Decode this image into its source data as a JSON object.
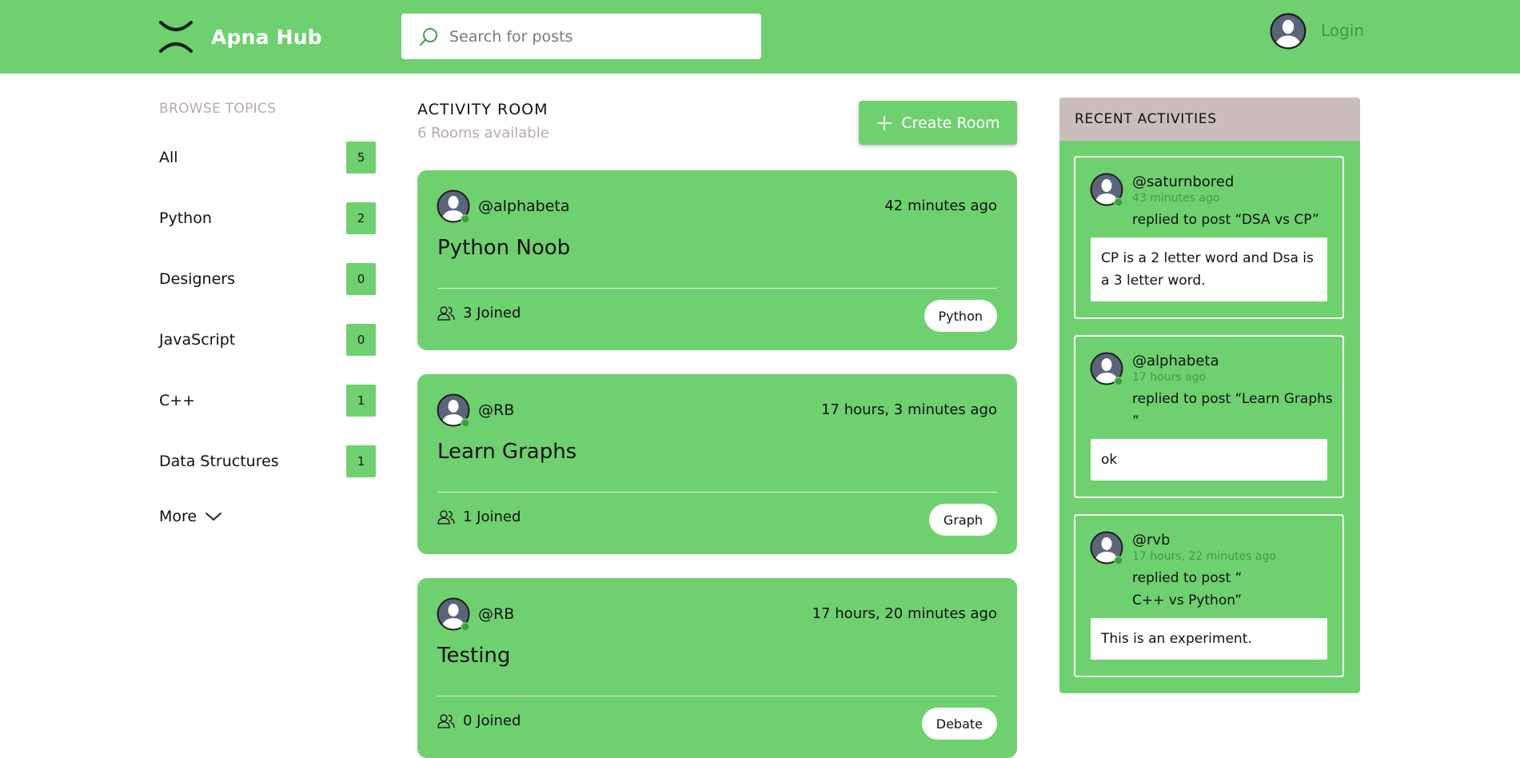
{
  "header": {
    "brand": "Apna Hub",
    "search_placeholder": "Search for posts",
    "login_label": "Login"
  },
  "topics": {
    "title": "BROWSE TOPICS",
    "items": [
      {
        "label": "All",
        "count": "5"
      },
      {
        "label": "Python",
        "count": "2"
      },
      {
        "label": "Designers",
        "count": "0"
      },
      {
        "label": "JavaScript",
        "count": "0"
      },
      {
        "label": "C++",
        "count": "1"
      },
      {
        "label": "Data Structures",
        "count": "1"
      }
    ],
    "more_label": "More"
  },
  "feed": {
    "title": "ACTIVITY ROOM",
    "subtitle": "6 Rooms available",
    "create_label": "Create Room",
    "rooms": [
      {
        "host": "@alphabeta",
        "time": "42 minutes ago",
        "title": "Python Noob",
        "joined": "3 Joined",
        "topic": "Python"
      },
      {
        "host": "@RB",
        "time": "17 hours, 3 minutes ago",
        "title": "Learn Graphs",
        "joined": "1 Joined",
        "topic": "Graph"
      },
      {
        "host": "@RB",
        "time": "17 hours, 20 minutes ago",
        "title": "Testing",
        "joined": "0 Joined",
        "topic": "Debate"
      }
    ]
  },
  "activities": {
    "title": "RECENT ACTIVITIES",
    "items": [
      {
        "user": "@saturnbored",
        "time": "43 minutes ago",
        "action": "replied to post “DSA vs CP”",
        "message": "CP is a 2 letter word and Dsa is a 3 letter word."
      },
      {
        "user": "@alphabeta",
        "time": "17 hours ago",
        "action": "replied to post “Learn Graphs ”",
        "message": "ok"
      },
      {
        "user": "@rvb",
        "time": "17 hours, 22 minutes ago",
        "action": "replied to post “\nC++ vs Python”",
        "message": "This is an experiment."
      }
    ]
  },
  "colors": {
    "primary_green": "#6fd070",
    "muted_label": "#b9a9ab",
    "activities_header": "#cbbdbe",
    "online_dot": "#3f9e44",
    "link_green": "#3e9a45"
  },
  "icons": {
    "logo": "x-logo-icon",
    "search": "search-icon",
    "avatar": "user-avatar-icon",
    "plus": "plus-icon",
    "users": "users-icon",
    "chevron": "chevron-down-icon"
  }
}
